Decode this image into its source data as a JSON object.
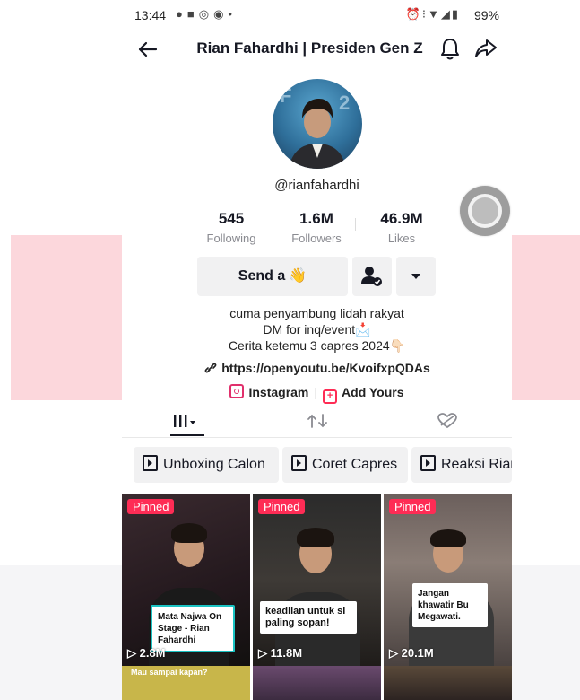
{
  "status_bar": {
    "time": "13:44",
    "battery": "99%",
    "left_icons": [
      "chat-icon",
      "bag-icon",
      "instagram-icon",
      "circle-icon",
      "dot-icon"
    ],
    "right_icons": [
      "alarm-icon",
      "vibrate-icon",
      "wifi-icon",
      "signal-icon",
      "battery-icon"
    ]
  },
  "header": {
    "title": "Rian Fahardhi | Presiden Gen Z"
  },
  "profile": {
    "handle": "@rianfahardhi",
    "stats": [
      {
        "value": "545",
        "label": "Following"
      },
      {
        "value": "1.6M",
        "label": "Followers"
      },
      {
        "value": "46.9M",
        "label": "Likes"
      }
    ]
  },
  "actions": {
    "send_label": "Send a",
    "send_emoji": "👋"
  },
  "bio": {
    "line1": "cuma penyambung lidah rakyat",
    "line2": "DM for inq/event📩",
    "line3": "Cerita ketemu 3 capres 2024👇🏻",
    "link": "https://openyoutu.be/KvoifxpQDAs",
    "instagram_label": "Instagram",
    "add_yours_label": "Add Yours"
  },
  "tabs": [
    "videos-tab",
    "reposts-tab",
    "liked-tab"
  ],
  "playlists": [
    "Unboxing Calon",
    "Coret Capres",
    "Reaksi Rian"
  ],
  "videos": [
    {
      "pinned": "Pinned",
      "views": "2.8M",
      "caption": "Mata Najwa On Stage - Rian Fahardhi"
    },
    {
      "pinned": "Pinned",
      "views": "11.8M",
      "caption": "keadilan untuk si paling sopan!"
    },
    {
      "pinned": "Pinned",
      "views": "20.1M",
      "caption": "Jangan khawatir Bu Megawati."
    }
  ],
  "videos_row2": [
    "Mau sampai kapan?",
    "",
    ""
  ],
  "colors": {
    "accent": "#fe2c55",
    "button_bg": "#f1f1f2",
    "muted_text": "#8a8b91"
  }
}
